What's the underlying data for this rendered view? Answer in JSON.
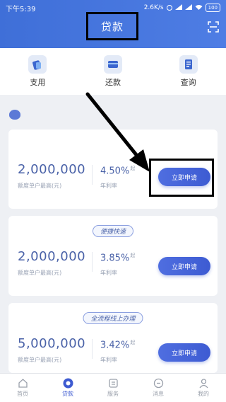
{
  "status": {
    "time": "下午5:39",
    "network_speed": "2.6K/s",
    "battery": "100"
  },
  "header": {
    "title": "贷款"
  },
  "quicknav": [
    {
      "label": "支用",
      "icon": "wallet-card-icon"
    },
    {
      "label": "还款",
      "icon": "card-icon"
    },
    {
      "label": "查询",
      "icon": "document-icon"
    }
  ],
  "loans": [
    {
      "amount": "2,000,000",
      "amount_label": "额度单户最高(元)",
      "rate": "4.50%",
      "rate_suffix": "起",
      "rate_label": "年利率",
      "button": "立即申请",
      "tag": ""
    },
    {
      "amount": "2,000,000",
      "amount_label": "额度单户最高(元)",
      "rate": "3.85%",
      "rate_suffix": "起",
      "rate_label": "年利率",
      "button": "立即申请",
      "tag": "便捷快速"
    },
    {
      "amount": "5,000,000",
      "amount_label": "额度单户最高(元)",
      "rate": "3.42%",
      "rate_suffix": "起",
      "rate_label": "年利率",
      "button": "立即申请",
      "tag": "全流程线上办理"
    }
  ],
  "tabs": [
    {
      "label": "首页",
      "icon": "home-icon"
    },
    {
      "label": "贷款",
      "icon": "loan-icon"
    },
    {
      "label": "服务",
      "icon": "service-icon"
    },
    {
      "label": "消息",
      "icon": "message-icon"
    },
    {
      "label": "我的",
      "icon": "profile-icon"
    }
  ],
  "colors": {
    "brand": "#4373dc",
    "accent": "#3e5bd1",
    "amount_text": "#4a62a8",
    "annotation": "#000000"
  }
}
